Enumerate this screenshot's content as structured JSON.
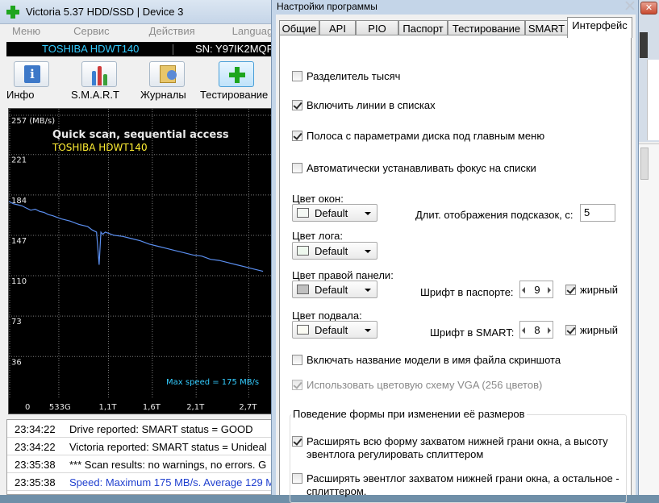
{
  "victoria": {
    "title": "Victoria 5.37 HDD/SSD | Device 3",
    "menu": [
      "Меню",
      "Сервис",
      "Действия",
      "Language"
    ],
    "device": {
      "model": "TOSHIBA HDWT140",
      "serial": "SN: Y97IK2MQF"
    },
    "toolbar": [
      "Инфо",
      "S.M.A.R.T",
      "Журналы",
      "Тестирование"
    ],
    "graph": {
      "title": "Quick scan, sequential access",
      "subtitle": "TOSHIBA HDWT140",
      "max_speed_label": "Max speed = 175 MB/s",
      "colors": {
        "grid": "#7a7a7a",
        "line": "#5b8ff0",
        "axis_text": "#e8e8e8",
        "title": "#e8e8e8",
        "subtitle": "#ffee33",
        "note": "#33ccff"
      }
    },
    "log": [
      {
        "time": "23:34:22",
        "message": "Drive reported: SMART status = GOOD"
      },
      {
        "time": "23:34:22",
        "message": "Victoria reported: SMART status = Unideal"
      },
      {
        "time": "23:35:38",
        "message": "*** Scan results: no warnings, no errors. G"
      },
      {
        "time": "23:35:38",
        "message": "Speed: Maximum 175 MB/s. Average 129 M"
      }
    ]
  },
  "chart_data": {
    "type": "line",
    "title": "Quick scan, sequential access",
    "subtitle": "TOSHIBA HDWT140",
    "ylabel": "257 (MB/s)",
    "yticks": [
      "257 (MB/s)",
      "221",
      "184",
      "147",
      "110",
      "73",
      "36"
    ],
    "xticks": [
      "0",
      "533G",
      "1,1T",
      "1,6T",
      "2,1T",
      "2,7T"
    ],
    "ylim": [
      0,
      257
    ],
    "grid": true,
    "annotation": "Max speed = 175 MB/s",
    "series": [
      {
        "x": [
          0,
          50,
          100,
          150,
          200,
          250,
          300,
          350,
          400,
          450,
          500,
          533,
          600,
          700,
          800,
          900,
          950,
          1000,
          1030,
          1050,
          1070,
          1100,
          1200,
          1300,
          1400,
          1500,
          1600,
          1700,
          1800,
          1900,
          2000,
          2100,
          2200,
          2300,
          2400,
          2500,
          2600,
          2700,
          2800,
          2900
        ],
        "y": [
          178,
          176,
          175,
          174,
          172,
          170,
          171,
          169,
          168,
          166,
          165,
          164,
          162,
          160,
          157,
          155,
          152,
          150,
          120,
          150,
          148,
          150,
          147,
          146,
          144,
          142,
          139,
          137,
          135,
          133,
          131,
          129,
          128,
          125,
          124,
          122,
          120,
          118,
          116,
          114
        ]
      }
    ]
  },
  "dialog": {
    "title": "Настройки программы",
    "tabs": [
      "Общие",
      "API",
      "PIO",
      "Паспорт",
      "Тестирование",
      "SMART",
      "Интерфейс"
    ],
    "checks": {
      "thousands": {
        "label": "Разделитель тысяч",
        "checked": false
      },
      "grid_lines": {
        "label": "Включить линии в списках",
        "checked": true
      },
      "disk_bar": {
        "label": "Полоса с параметрами диска под главным меню",
        "checked": true
      },
      "auto_focus": {
        "label": "Автоматически устанавливать фокус на списки",
        "checked": false
      },
      "model_in_filename": {
        "label": "Включать название модели в имя файла скриншота",
        "checked": false
      },
      "vga_scheme": {
        "label": "Использовать цветовую схему VGA (256 цветов)",
        "checked": true,
        "disabled": true
      }
    },
    "window_color": {
      "label": "Цвет окон:",
      "value": "Default",
      "swatch": "#f4f8f4"
    },
    "log_color": {
      "label": "Цвет лога:",
      "value": "Default",
      "swatch": "#eef8ee"
    },
    "right_panel_color": {
      "label": "Цвет правой панели:",
      "value": "Default",
      "swatch": "#c0c0c0"
    },
    "footer_color": {
      "label": "Цвет подвала:",
      "value": "Default",
      "swatch": "#fbfbf3"
    },
    "tooltip_duration": {
      "label": "Длит. отображения подсказок, с:",
      "value": "5"
    },
    "passport_font": {
      "label": "Шрифт в паспорте:",
      "value": "9",
      "bold_label": "жирный",
      "bold": true
    },
    "smart_font": {
      "label": "Шрифт в SMART:",
      "value": "8",
      "bold_label": "жирный",
      "bold": true
    },
    "resize_group": {
      "title": "Поведение формы при изменении её размеров",
      "option_1": {
        "label": "Расширять всю форму захватом нижней грани окна, а высоту эвентлога регулировать сплиттером",
        "checked": true
      },
      "option_2": {
        "label": "Расширять эвентлог захватом нижней грани окна, а остальное - сплиттером.",
        "checked": false
      }
    }
  }
}
